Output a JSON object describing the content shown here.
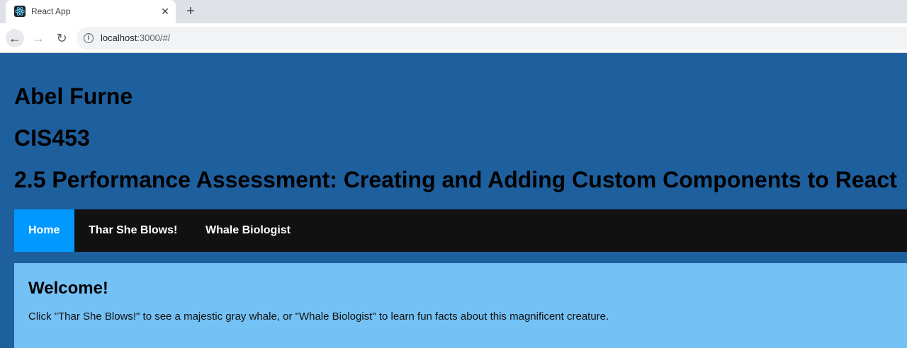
{
  "browser": {
    "tab_title": "React App",
    "url_host": "localhost",
    "url_rest": ":3000/#/",
    "close_glyph": "✕",
    "new_tab_glyph": "+",
    "back_glyph": "←",
    "forward_glyph": "→",
    "reload_glyph": "↻",
    "info_glyph": "i"
  },
  "header": {
    "name": "Abel Furne",
    "course": "CIS453",
    "assignment": "2.5 Performance Assessment: Creating and Adding Custom Components to React"
  },
  "nav": {
    "items": [
      {
        "label": "Home",
        "active": true
      },
      {
        "label": "Thar She Blows!",
        "active": false
      },
      {
        "label": "Whale Biologist",
        "active": false
      }
    ]
  },
  "content": {
    "heading": "Welcome!",
    "text": "Click \"Thar She Blows!\" to see a majestic gray whale, or \"Whale Biologist\" to learn fun facts about this magnificent creature."
  },
  "colors": {
    "page_bg": "#1e5f9e",
    "nav_bg": "#111111",
    "nav_active": "#0099ff",
    "content_bg": "#74c1f5"
  }
}
